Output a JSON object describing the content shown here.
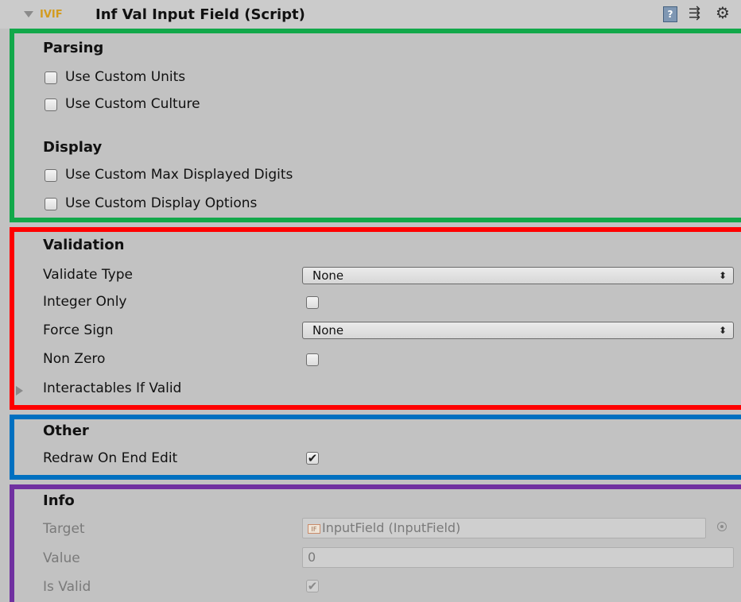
{
  "header": {
    "title": "Inf Val Input Field (Script)",
    "script_icon_text": "IVIF",
    "help_icon_text": "?",
    "preset_icon_text": "⇶",
    "gear_icon_text": "⚙"
  },
  "parsing": {
    "heading": "Parsing",
    "use_custom_units": {
      "label": "Use Custom Units",
      "checked": false
    },
    "use_custom_culture": {
      "label": "Use Custom Culture",
      "checked": false
    }
  },
  "display": {
    "heading": "Display",
    "use_custom_max_displayed_digits": {
      "label": "Use Custom Max Displayed Digits",
      "checked": false
    },
    "use_custom_display_options": {
      "label": "Use Custom Display Options",
      "checked": false
    }
  },
  "validation": {
    "heading": "Validation",
    "validate_type": {
      "label": "Validate Type",
      "value": "None",
      "arrow": "⬍"
    },
    "integer_only": {
      "label": "Integer Only",
      "checked": false
    },
    "force_sign": {
      "label": "Force Sign",
      "value": "None",
      "arrow": "⬍"
    },
    "non_zero": {
      "label": "Non Zero",
      "checked": false
    },
    "interactables_if_valid": {
      "label": "Interactables If Valid",
      "expanded": false
    }
  },
  "other": {
    "heading": "Other",
    "redraw_on_end_edit": {
      "label": "Redraw On End Edit",
      "checked": true,
      "mark": "✔"
    }
  },
  "info": {
    "heading": "Info",
    "target": {
      "label": "Target",
      "value": "InputField (InputField)",
      "icon_text": "IF"
    },
    "value": {
      "label": "Value",
      "value": "0"
    },
    "is_valid": {
      "label": "Is Valid",
      "checked": true,
      "mark": "✔"
    }
  },
  "colors": {
    "parsing_display_box": "#12a84a",
    "validation_box": "#ff0000",
    "other_box": "#0070c0",
    "info_box": "#7030a0",
    "panel_background": "#c2c2c2"
  }
}
